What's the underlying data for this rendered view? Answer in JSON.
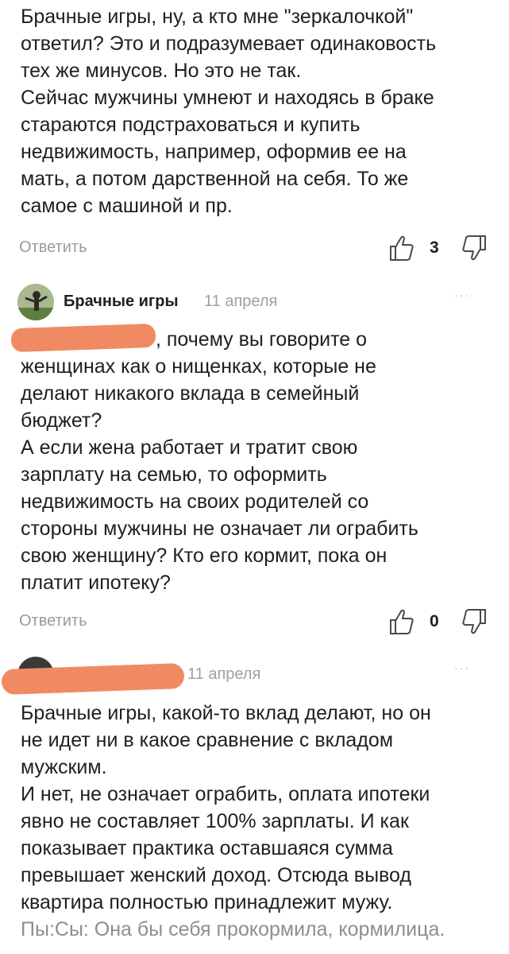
{
  "comments": [
    {
      "lines": [
        "Брачные игры, ну, а кто мне \"зеркалочкой\"",
        "ответил? Это и подразумевает одинаковость",
        "тех же минусов. Но это не так.",
        "Сейчас мужчины умнеют и находясь в браке",
        "стараются подстраховаться и купить",
        "недвижимость, например, оформив ее на",
        "мать, а потом дарственной на себя. То же",
        "самое с машиной и пр."
      ],
      "reply_label": "Ответить",
      "likes": "3"
    },
    {
      "author": "Брачные игры",
      "date": "11 апреля",
      "first_line_visible": ", почему вы говорите о",
      "lines": [
        "женщинах как о нищенках, которые не",
        "делают никакого вклада в семейный",
        "бюджет?",
        "А если жена работает и тратит свою",
        "зарплату на семью, то оформить",
        "недвижимость на своих родителей со",
        "стороны мужчины не означает ли ограбить",
        "свою женщину? Кто его кормит, пока он",
        "платит ипотеку?"
      ],
      "reply_label": "Ответить",
      "likes": "0"
    },
    {
      "date": "11 апреля",
      "lines": [
        "Брачные игры, какой-то вклад делают, но он",
        "не идет ни в какое сравнение с вкладом",
        "мужским.",
        "И нет, не означает ограбить, оплата ипотеки",
        "явно не составляет 100% зарплаты. И как",
        "показывает практика оставшаяся сумма",
        "превышает женский доход. Отсюда вывод",
        "квартира полностью принадлежит мужу."
      ],
      "last_line_gray": "Пы:Сы: Она бы себя прокормила, кормилица."
    }
  ],
  "more_glyph": "···",
  "icons": {
    "like": "thumbs-up-icon",
    "dislike": "thumbs-down-icon"
  }
}
